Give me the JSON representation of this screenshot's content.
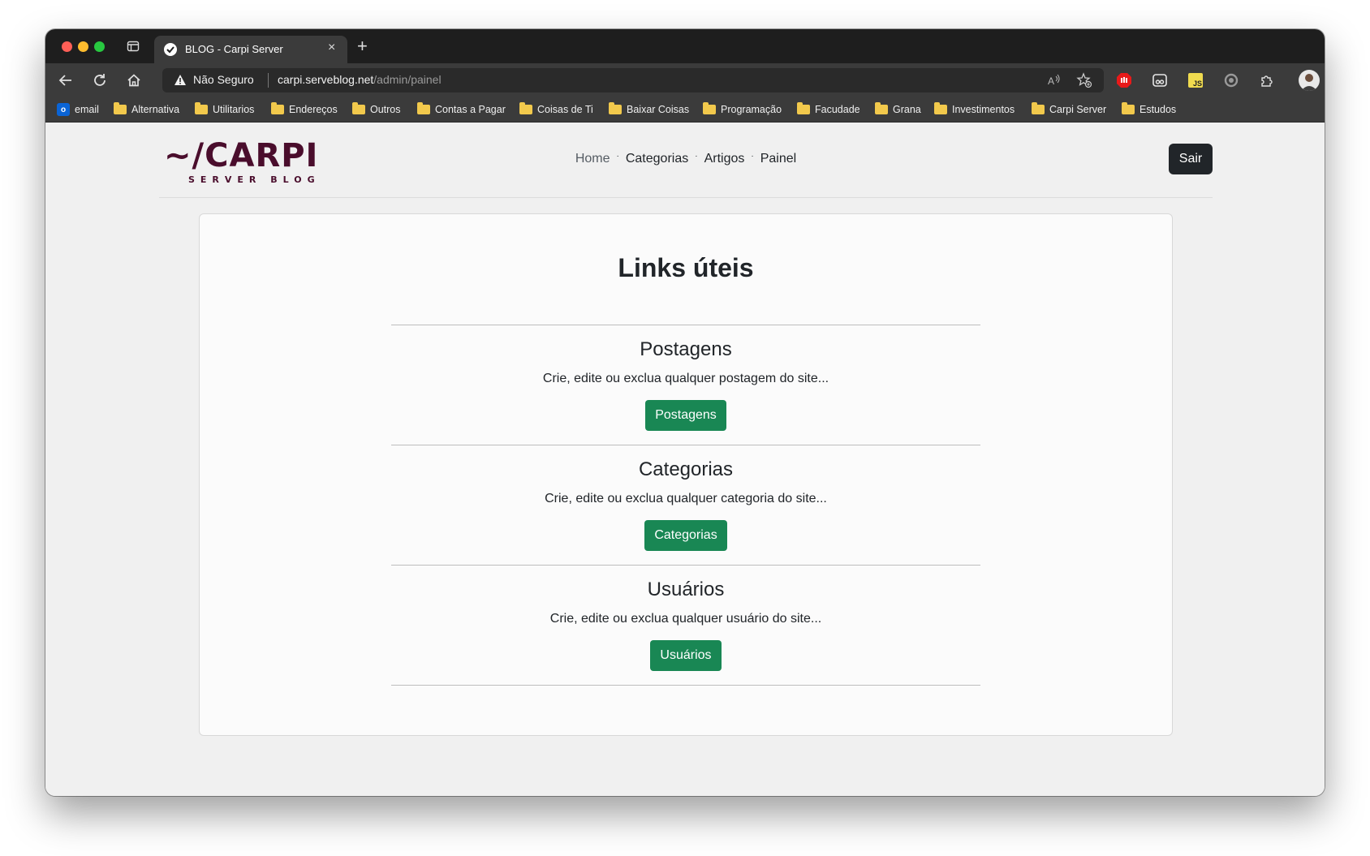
{
  "browser": {
    "tab_title": "BLOG - Carpi Server",
    "new_tab_symbol": "+",
    "close_symbol": "×",
    "security_status": "Não Seguro",
    "url_host": "carpi.serveblog.net",
    "url_path": "/admin/painel",
    "more_symbol": "···",
    "bookmarks": [
      {
        "label": "email",
        "icon": "outlook-icon"
      },
      {
        "label": "Alternativa",
        "icon": "folder-icon"
      },
      {
        "label": "Utilitarios",
        "icon": "folder-icon"
      },
      {
        "label": "Endereços",
        "icon": "folder-icon"
      },
      {
        "label": "Outros",
        "icon": "folder-icon"
      },
      {
        "label": "Contas a Pagar",
        "icon": "folder-icon"
      },
      {
        "label": "Coisas de Ti",
        "icon": "folder-icon"
      },
      {
        "label": "Baixar Coisas",
        "icon": "folder-icon"
      },
      {
        "label": "Programação",
        "icon": "folder-icon"
      },
      {
        "label": "Facudade",
        "icon": "folder-icon"
      },
      {
        "label": "Grana",
        "icon": "folder-icon"
      },
      {
        "label": "Investimentos",
        "icon": "folder-icon"
      },
      {
        "label": "Carpi Server",
        "icon": "folder-icon"
      },
      {
        "label": "Estudos",
        "icon": "folder-icon"
      }
    ]
  },
  "site": {
    "logo_main": "~/CARPI",
    "logo_sub": "SERVER BLOG",
    "brand_color": "#4a0d2c",
    "nav": [
      {
        "label": "Home"
      },
      {
        "label": "Categorias"
      },
      {
        "label": "Artigos"
      },
      {
        "label": "Painel"
      }
    ],
    "nav_separator": "·",
    "logout_label": "Sair"
  },
  "main": {
    "title": "Links úteis",
    "accent_color": "#198754",
    "sections": [
      {
        "title": "Postagens",
        "description": "Crie, edite ou exclua qualquer postagem do site...",
        "button": "Postagens"
      },
      {
        "title": "Categorias",
        "description": "Crie, edite ou exclua qualquer categoria do site...",
        "button": "Categorias"
      },
      {
        "title": "Usuários",
        "description": "Crie, edite ou exclua qualquer usuário do site...",
        "button": "Usuários"
      }
    ]
  }
}
